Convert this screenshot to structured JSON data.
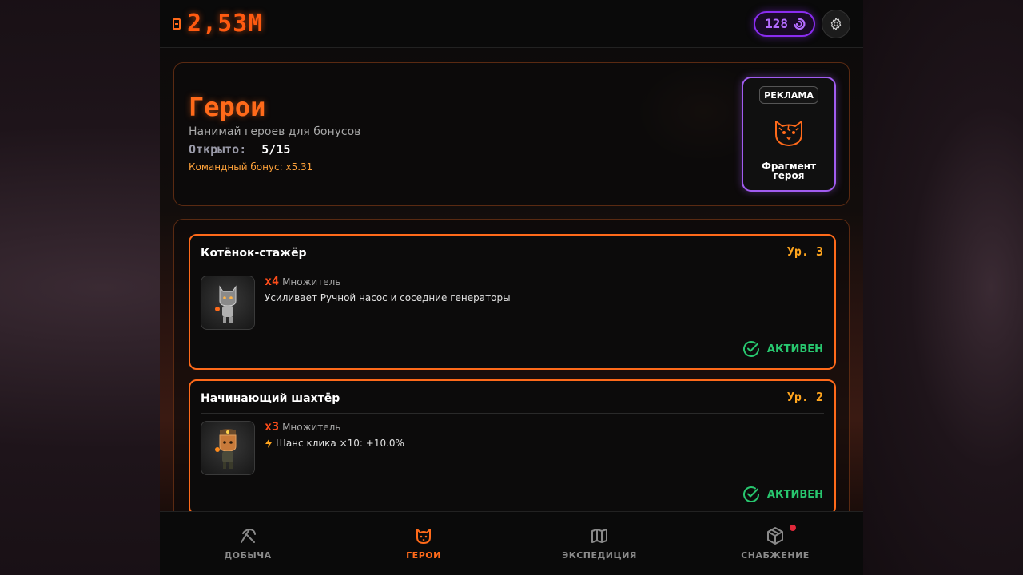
{
  "topbar": {
    "balance": "2,53M",
    "gems": "128"
  },
  "header": {
    "title": "Герои",
    "subtitle": "Нанимай героев для бонусов",
    "opened_label": "Открыто:",
    "opened_value": "5/15",
    "team_bonus": "Командный бонус: x5.31"
  },
  "ad": {
    "badge": "РЕКЛАМА",
    "label": "Фрагмент героя"
  },
  "heroes": [
    {
      "name": "Котёнок-стажёр",
      "level": "Ур. 3",
      "multiplier": "x4",
      "multiplier_label": "Множитель",
      "description": "Усиливает Ручной насос и соседние генераторы",
      "status": "АКТИВЕН"
    },
    {
      "name": "Начинающий шахтёр",
      "level": "Ур. 2",
      "multiplier": "x3",
      "multiplier_label": "Множитель",
      "description": "Шанс клика ×10: +10.0%",
      "status": "АКТИВЕН"
    }
  ],
  "nav": {
    "items": [
      {
        "label": "ДОБЫЧА",
        "icon": "pickaxe-icon"
      },
      {
        "label": "ГЕРОИ",
        "icon": "cat-icon",
        "active": true
      },
      {
        "label": "ЭКСПЕДИЦИЯ",
        "icon": "map-icon"
      },
      {
        "label": "СНАБЖЕНИЕ",
        "icon": "box-icon",
        "notification": true
      }
    ]
  },
  "colors": {
    "accent": "#ff6a1a",
    "gem": "#8a2cf0",
    "active": "#28c76f",
    "level": "#ffa51e"
  }
}
